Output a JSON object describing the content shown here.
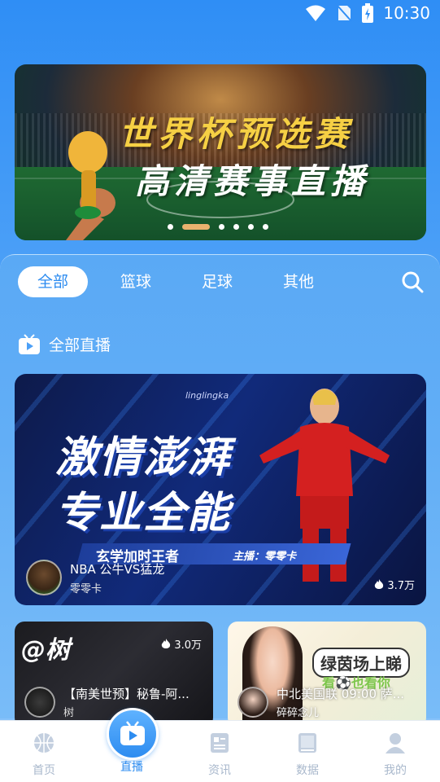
{
  "status_bar": {
    "time": "10:30"
  },
  "banner": {
    "title_line1": "世界杯预选赛",
    "title_line2": "高清赛事直播",
    "slide_count": 6,
    "active_slide": 2
  },
  "tabs": [
    {
      "label": "全部",
      "active": true
    },
    {
      "label": "篮球",
      "active": false
    },
    {
      "label": "足球",
      "active": false
    },
    {
      "label": "其他",
      "active": false
    }
  ],
  "section": {
    "title": "全部直播"
  },
  "featured_live": {
    "cover_text_line1": "激情澎湃",
    "cover_text_line2": "专业全能",
    "cover_brand": "linglingka",
    "cover_strip_text": "玄学加时王者",
    "cover_strip_host": "主播：零零卡",
    "title": "NBA 公牛VS猛龙",
    "streamer": "零零卡",
    "heat": "3.7万"
  },
  "live_cards": [
    {
      "cover_text": "@树",
      "title": "【南美世预】秘鲁-阿...",
      "streamer": "树",
      "heat": "3.0万"
    },
    {
      "cover_text_line1": "绿茵场上睇",
      "cover_text_line2": "看⚽也看你",
      "title": "中北美国联 09:00 萨...",
      "streamer": "碎碎念儿",
      "heat": ""
    }
  ],
  "bottom_nav": [
    {
      "label": "首页",
      "icon": "basketball-icon",
      "active": false
    },
    {
      "label": "直播",
      "icon": "tv-icon",
      "active": true
    },
    {
      "label": "资讯",
      "icon": "news-icon",
      "active": false
    },
    {
      "label": "数据",
      "icon": "book-icon",
      "active": false
    },
    {
      "label": "我的",
      "icon": "user-icon",
      "active": false
    }
  ],
  "colors": {
    "accent": "#2d8cf0",
    "nav_inactive": "#a9b8cc",
    "banner_gold": "#f6d044"
  }
}
